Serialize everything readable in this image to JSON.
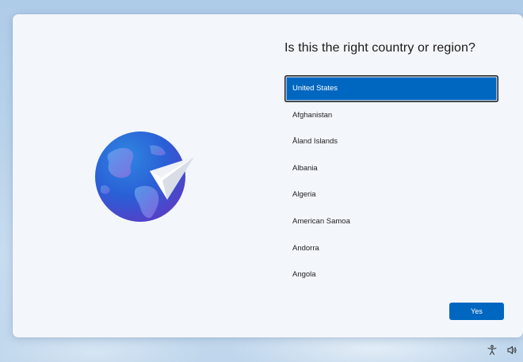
{
  "header": {
    "title": "Is this the right country or region?"
  },
  "countries": {
    "items": [
      {
        "label": "United States",
        "selected": true
      },
      {
        "label": "Afghanistan",
        "selected": false
      },
      {
        "label": "Åland Islands",
        "selected": false
      },
      {
        "label": "Albania",
        "selected": false
      },
      {
        "label": "Algeria",
        "selected": false
      },
      {
        "label": "American Samoa",
        "selected": false
      },
      {
        "label": "Andorra",
        "selected": false
      },
      {
        "label": "Angola",
        "selected": false
      }
    ]
  },
  "actions": {
    "yes_label": "Yes"
  },
  "illustration": {
    "icon": "globe-with-paper-plane-icon"
  },
  "taskbar": {
    "icons": [
      "accessibility-icon",
      "volume-icon"
    ]
  },
  "colors": {
    "accent": "#0067c0",
    "panel": "#f3f6fb"
  }
}
